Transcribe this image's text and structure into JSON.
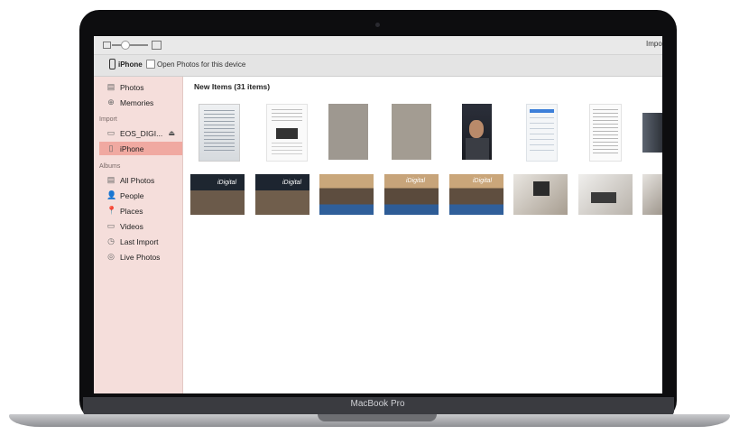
{
  "device": {
    "brand_label": "MacBook Pro"
  },
  "window": {
    "title": "Impo"
  },
  "toolbar": {
    "device_name": "iPhone",
    "open_photos_label": "Open Photos for this device"
  },
  "sidebar": {
    "items": [
      {
        "label": "Photos",
        "icon": "photos-icon"
      },
      {
        "label": "Memories",
        "icon": "memories-icon"
      }
    ],
    "import_heading": "Import",
    "import_items": [
      {
        "label": "EOS_DIGI...",
        "icon": "drive-icon"
      },
      {
        "label": "iPhone",
        "icon": "iphone-icon",
        "selected": true
      }
    ],
    "albums_heading": "Albums",
    "album_items": [
      {
        "label": "All Photos",
        "icon": "all-photos-icon"
      },
      {
        "label": "People",
        "icon": "people-icon"
      },
      {
        "label": "Places",
        "icon": "places-icon"
      },
      {
        "label": "Videos",
        "icon": "videos-icon"
      },
      {
        "label": "Last Import",
        "icon": "clock-icon"
      },
      {
        "label": "Live Photos",
        "icon": "live-photos-icon"
      }
    ]
  },
  "main": {
    "section_title": "New Items (31 items)",
    "thumbnails_row1": [
      "document-scan",
      "document-screenshot",
      "blank-gray",
      "blank-gray",
      "selfie",
      "phone-screenshot",
      "document-screenshot",
      "people-cropped"
    ],
    "thumbnails_row2": [
      "store-front",
      "store-front",
      "store-event",
      "store-event",
      "store-event",
      "store-display",
      "store-display",
      "store-display"
    ],
    "store_sign": "iDigital"
  }
}
